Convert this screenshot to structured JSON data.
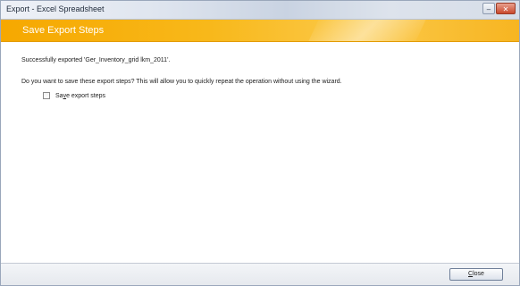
{
  "window": {
    "title": "Export - Excel Spreadsheet"
  },
  "header": {
    "title": "Save Export Steps"
  },
  "content": {
    "success_message": "Successfully exported 'Ger_Inventory_grid lkm_2011'.",
    "question": "Do you want to save these export steps? This will allow you to quickly repeat the operation without using the wizard.",
    "checkbox": {
      "label_prefix": "Sa",
      "label_mnemonic": "v",
      "label_suffix": "e export steps",
      "checked": false
    }
  },
  "footer": {
    "close_prefix": "",
    "close_mnemonic": "C",
    "close_suffix": "lose"
  },
  "colors": {
    "header_orange": "#f6a800",
    "titlebar": "#dfe5ef"
  }
}
